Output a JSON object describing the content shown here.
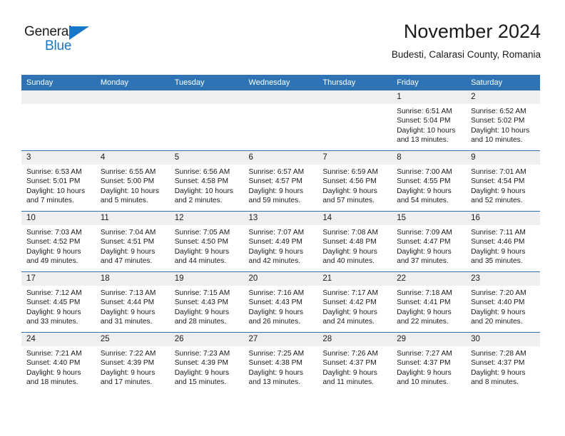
{
  "brand": {
    "name_part1": "General",
    "name_part2": "Blue",
    "accent_color": "#1877c9"
  },
  "header": {
    "title": "November 2024",
    "subtitle": "Budesti, Calarasi County, Romania"
  },
  "theme": {
    "header_blue": "#2e74b5",
    "daynum_band": "#efefef",
    "text": "#1a1a1a"
  },
  "columns": [
    "Sunday",
    "Monday",
    "Tuesday",
    "Wednesday",
    "Thursday",
    "Friday",
    "Saturday"
  ],
  "weeks": [
    [
      {
        "day": "",
        "lines": []
      },
      {
        "day": "",
        "lines": []
      },
      {
        "day": "",
        "lines": []
      },
      {
        "day": "",
        "lines": []
      },
      {
        "day": "",
        "lines": []
      },
      {
        "day": "1",
        "lines": [
          "Sunrise: 6:51 AM",
          "Sunset: 5:04 PM",
          "Daylight: 10 hours",
          "and 13 minutes."
        ]
      },
      {
        "day": "2",
        "lines": [
          "Sunrise: 6:52 AM",
          "Sunset: 5:02 PM",
          "Daylight: 10 hours",
          "and 10 minutes."
        ]
      }
    ],
    [
      {
        "day": "3",
        "lines": [
          "Sunrise: 6:53 AM",
          "Sunset: 5:01 PM",
          "Daylight: 10 hours",
          "and 7 minutes."
        ]
      },
      {
        "day": "4",
        "lines": [
          "Sunrise: 6:55 AM",
          "Sunset: 5:00 PM",
          "Daylight: 10 hours",
          "and 5 minutes."
        ]
      },
      {
        "day": "5",
        "lines": [
          "Sunrise: 6:56 AM",
          "Sunset: 4:58 PM",
          "Daylight: 10 hours",
          "and 2 minutes."
        ]
      },
      {
        "day": "6",
        "lines": [
          "Sunrise: 6:57 AM",
          "Sunset: 4:57 PM",
          "Daylight: 9 hours",
          "and 59 minutes."
        ]
      },
      {
        "day": "7",
        "lines": [
          "Sunrise: 6:59 AM",
          "Sunset: 4:56 PM",
          "Daylight: 9 hours",
          "and 57 minutes."
        ]
      },
      {
        "day": "8",
        "lines": [
          "Sunrise: 7:00 AM",
          "Sunset: 4:55 PM",
          "Daylight: 9 hours",
          "and 54 minutes."
        ]
      },
      {
        "day": "9",
        "lines": [
          "Sunrise: 7:01 AM",
          "Sunset: 4:54 PM",
          "Daylight: 9 hours",
          "and 52 minutes."
        ]
      }
    ],
    [
      {
        "day": "10",
        "lines": [
          "Sunrise: 7:03 AM",
          "Sunset: 4:52 PM",
          "Daylight: 9 hours",
          "and 49 minutes."
        ]
      },
      {
        "day": "11",
        "lines": [
          "Sunrise: 7:04 AM",
          "Sunset: 4:51 PM",
          "Daylight: 9 hours",
          "and 47 minutes."
        ]
      },
      {
        "day": "12",
        "lines": [
          "Sunrise: 7:05 AM",
          "Sunset: 4:50 PM",
          "Daylight: 9 hours",
          "and 44 minutes."
        ]
      },
      {
        "day": "13",
        "lines": [
          "Sunrise: 7:07 AM",
          "Sunset: 4:49 PM",
          "Daylight: 9 hours",
          "and 42 minutes."
        ]
      },
      {
        "day": "14",
        "lines": [
          "Sunrise: 7:08 AM",
          "Sunset: 4:48 PM",
          "Daylight: 9 hours",
          "and 40 minutes."
        ]
      },
      {
        "day": "15",
        "lines": [
          "Sunrise: 7:09 AM",
          "Sunset: 4:47 PM",
          "Daylight: 9 hours",
          "and 37 minutes."
        ]
      },
      {
        "day": "16",
        "lines": [
          "Sunrise: 7:11 AM",
          "Sunset: 4:46 PM",
          "Daylight: 9 hours",
          "and 35 minutes."
        ]
      }
    ],
    [
      {
        "day": "17",
        "lines": [
          "Sunrise: 7:12 AM",
          "Sunset: 4:45 PM",
          "Daylight: 9 hours",
          "and 33 minutes."
        ]
      },
      {
        "day": "18",
        "lines": [
          "Sunrise: 7:13 AM",
          "Sunset: 4:44 PM",
          "Daylight: 9 hours",
          "and 31 minutes."
        ]
      },
      {
        "day": "19",
        "lines": [
          "Sunrise: 7:15 AM",
          "Sunset: 4:43 PM",
          "Daylight: 9 hours",
          "and 28 minutes."
        ]
      },
      {
        "day": "20",
        "lines": [
          "Sunrise: 7:16 AM",
          "Sunset: 4:43 PM",
          "Daylight: 9 hours",
          "and 26 minutes."
        ]
      },
      {
        "day": "21",
        "lines": [
          "Sunrise: 7:17 AM",
          "Sunset: 4:42 PM",
          "Daylight: 9 hours",
          "and 24 minutes."
        ]
      },
      {
        "day": "22",
        "lines": [
          "Sunrise: 7:18 AM",
          "Sunset: 4:41 PM",
          "Daylight: 9 hours",
          "and 22 minutes."
        ]
      },
      {
        "day": "23",
        "lines": [
          "Sunrise: 7:20 AM",
          "Sunset: 4:40 PM",
          "Daylight: 9 hours",
          "and 20 minutes."
        ]
      }
    ],
    [
      {
        "day": "24",
        "lines": [
          "Sunrise: 7:21 AM",
          "Sunset: 4:40 PM",
          "Daylight: 9 hours",
          "and 18 minutes."
        ]
      },
      {
        "day": "25",
        "lines": [
          "Sunrise: 7:22 AM",
          "Sunset: 4:39 PM",
          "Daylight: 9 hours",
          "and 17 minutes."
        ]
      },
      {
        "day": "26",
        "lines": [
          "Sunrise: 7:23 AM",
          "Sunset: 4:39 PM",
          "Daylight: 9 hours",
          "and 15 minutes."
        ]
      },
      {
        "day": "27",
        "lines": [
          "Sunrise: 7:25 AM",
          "Sunset: 4:38 PM",
          "Daylight: 9 hours",
          "and 13 minutes."
        ]
      },
      {
        "day": "28",
        "lines": [
          "Sunrise: 7:26 AM",
          "Sunset: 4:37 PM",
          "Daylight: 9 hours",
          "and 11 minutes."
        ]
      },
      {
        "day": "29",
        "lines": [
          "Sunrise: 7:27 AM",
          "Sunset: 4:37 PM",
          "Daylight: 9 hours",
          "and 10 minutes."
        ]
      },
      {
        "day": "30",
        "lines": [
          "Sunrise: 7:28 AM",
          "Sunset: 4:37 PM",
          "Daylight: 9 hours",
          "and 8 minutes."
        ]
      }
    ]
  ]
}
